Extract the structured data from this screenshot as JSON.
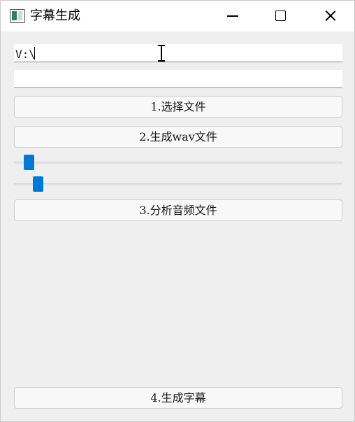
{
  "window": {
    "title": "字幕生成"
  },
  "inputs": {
    "path_value": "V:\\",
    "second_value": ""
  },
  "buttons": {
    "select_file": "1.选择文件",
    "generate_wav": "2.生成wav文件",
    "analyze_audio": "3.分析音频文件",
    "generate_subtitles": "4.生成字幕"
  },
  "sliders": [
    {
      "value_fraction": 0.03
    },
    {
      "value_fraction": 0.06
    }
  ],
  "colors": {
    "accent": "#0078d4",
    "background": "#efefef",
    "titlebar": "#ffffff"
  },
  "icons": [
    "app-window-icon",
    "minimize-icon",
    "maximize-icon",
    "close-icon",
    "text-cursor-icon"
  ]
}
